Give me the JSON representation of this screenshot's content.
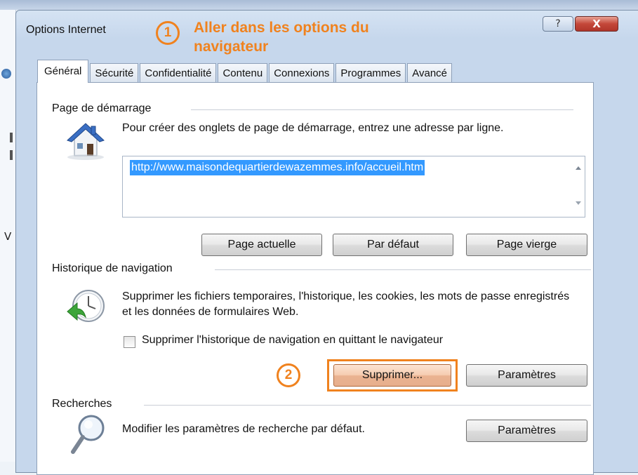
{
  "window": {
    "title": "Options Internet",
    "help_glyph": "?",
    "close_glyph": "X",
    "accent_color": "#f0821e"
  },
  "annotations": {
    "step1_number": "1",
    "step1_text": "Aller dans les options du navigateur",
    "step2_number": "2"
  },
  "tabs": [
    {
      "label": "Général",
      "active": true
    },
    {
      "label": "Sécurité"
    },
    {
      "label": "Confidentialité"
    },
    {
      "label": "Contenu"
    },
    {
      "label": "Connexions"
    },
    {
      "label": "Programmes"
    },
    {
      "label": "Avancé"
    }
  ],
  "home": {
    "header": "Page de démarrage",
    "description": "Pour créer des onglets de page de démarrage, entrez une adresse par ligne.",
    "url": "http://www.maisondequartierdewazemmes.info/accueil.htm",
    "buttons": {
      "current": "Page actuelle",
      "default": "Par défaut",
      "blank": "Page vierge"
    },
    "icon": "house-icon"
  },
  "history": {
    "header": "Historique de navigation",
    "description": "Supprimer les fichiers temporaires, l'historique, les cookies, les mots de passe enregistrés et les données de formulaires Web.",
    "checkbox_label": "Supprimer l'historique de navigation en quittant le navigateur",
    "checkbox_checked": false,
    "delete_button": "Supprimer...",
    "settings_button": "Paramètres",
    "icon": "history-clock-icon"
  },
  "search": {
    "header": "Recherches",
    "description": "Modifier les paramètres de recherche par défaut.",
    "settings_button": "Paramètres",
    "icon": "magnifier-icon"
  }
}
